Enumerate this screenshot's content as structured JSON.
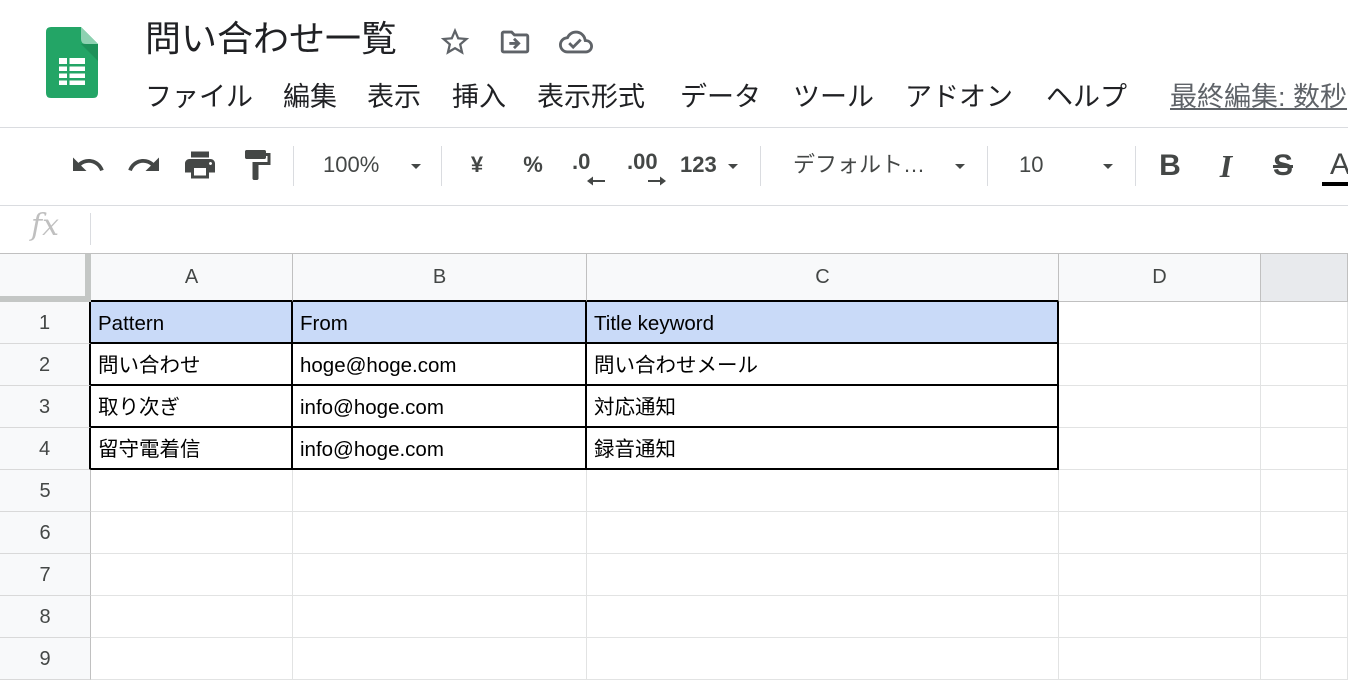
{
  "document": {
    "title": "問い合わせ一覧",
    "logo_icon": "sheets-logo-icon",
    "brand_color": "#23a566"
  },
  "header_icons": [
    "star-icon",
    "folder-move-icon",
    "cloud-done-icon"
  ],
  "menu": {
    "items": [
      "ファイル",
      "編集",
      "表示",
      "挿入",
      "表示形式",
      "データ",
      "ツール",
      "アドオン",
      "ヘルプ"
    ],
    "last_edit": "最終編集: 数秒"
  },
  "toolbar": {
    "icons": [
      "undo-icon",
      "redo-icon",
      "print-icon",
      "paint-format-icon"
    ],
    "zoom": "100%",
    "currency": "¥",
    "percent": "%",
    "decrease_decimal": ".0",
    "increase_decimal": ".00",
    "more_formats": "123",
    "font_family": "デフォルト…",
    "font_size": "10",
    "bold": "B",
    "italic": "I",
    "strikethrough": "S",
    "text_color": "A",
    "text_color_value": "#000000"
  },
  "formula_bar": {
    "label": "fx",
    "value": ""
  },
  "sheet": {
    "columns": [
      "A",
      "B",
      "C",
      "D",
      ""
    ],
    "header_fill": "#c9daf8",
    "range_border_color": "#000000",
    "rows": [
      {
        "number": "1",
        "cells": [
          "Pattern",
          "From",
          "Title keyword"
        ]
      },
      {
        "number": "2",
        "cells": [
          "問い合わせ",
          "hoge@hoge.com",
          "問い合わせメール"
        ]
      },
      {
        "number": "3",
        "cells": [
          "取り次ぎ",
          "info@hoge.com",
          "対応通知"
        ]
      },
      {
        "number": "4",
        "cells": [
          "留守電着信",
          "info@hoge.com",
          "録音通知"
        ]
      },
      {
        "number": "5",
        "cells": []
      },
      {
        "number": "6",
        "cells": []
      },
      {
        "number": "7",
        "cells": []
      },
      {
        "number": "8",
        "cells": []
      },
      {
        "number": "9",
        "cells": []
      }
    ]
  }
}
